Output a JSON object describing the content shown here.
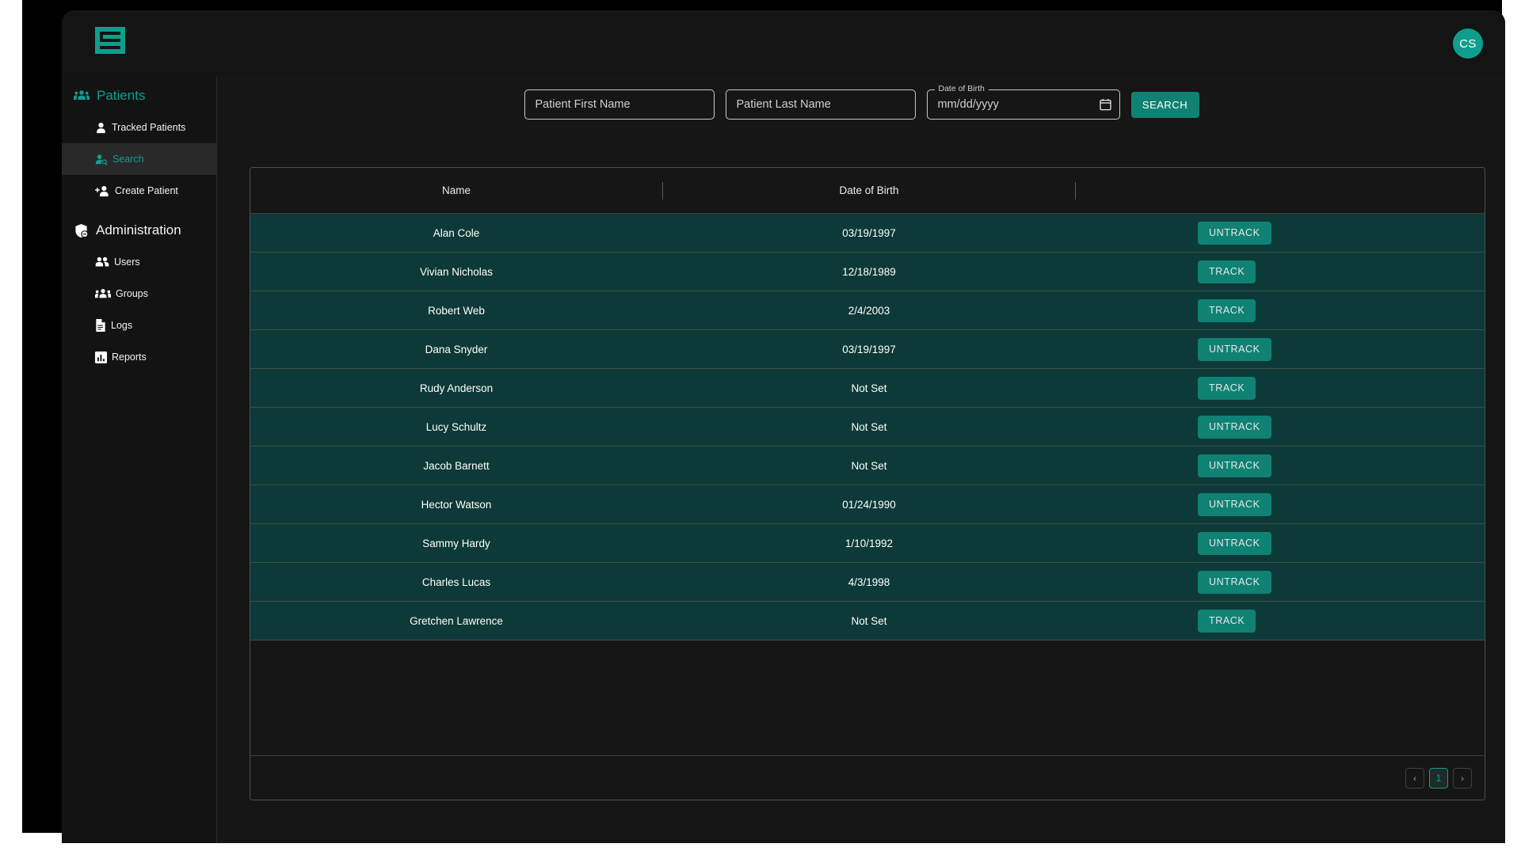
{
  "brand": {
    "logo_icon": "s-monogram-logo",
    "accent_color": "#0f9e8e",
    "button_color": "#0f8274",
    "row_color": "#0d3a38",
    "panel_color": "#161616"
  },
  "topbar": {
    "avatar_initials": "CS"
  },
  "sidebar": {
    "groups": [
      {
        "label": "Patients",
        "icon": "group-people-icon",
        "items": [
          {
            "label": "Tracked Patients",
            "icon": "person-icon",
            "active": false
          },
          {
            "label": "Search",
            "icon": "person-search-icon",
            "active": true
          },
          {
            "label": "Create Patient",
            "icon": "person-add-icon",
            "active": false
          }
        ]
      },
      {
        "label": "Administration",
        "icon": "admin-shield-icon",
        "items": [
          {
            "label": "Users",
            "icon": "users-icon",
            "active": false
          },
          {
            "label": "Groups",
            "icon": "groups-icon",
            "active": false
          },
          {
            "label": "Logs",
            "icon": "document-icon",
            "active": false
          },
          {
            "label": "Reports",
            "icon": "bar-chart-icon",
            "active": false
          }
        ]
      }
    ]
  },
  "search": {
    "first_name_placeholder": "Patient First Name",
    "first_name_value": "",
    "last_name_placeholder": "Patient Last Name",
    "last_name_value": "",
    "dob_legend": "Date of Birth",
    "dob_placeholder": "mm/dd/yyyy",
    "dob_value": "",
    "calendar_icon": "calendar-icon",
    "search_button_label": "SEARCH"
  },
  "table": {
    "columns": [
      "Name",
      "Date of Birth",
      ""
    ],
    "rows": [
      {
        "name": "Alan Cole",
        "dob": "03/19/1997",
        "action": "UNTRACK"
      },
      {
        "name": "Vivian Nicholas",
        "dob": "12/18/1989",
        "action": "TRACK"
      },
      {
        "name": "Robert Web",
        "dob": "2/4/2003",
        "action": "TRACK"
      },
      {
        "name": "Dana Snyder",
        "dob": "03/19/1997",
        "action": "UNTRACK"
      },
      {
        "name": "Rudy Anderson",
        "dob": "Not Set",
        "action": "TRACK"
      },
      {
        "name": "Lucy Schultz",
        "dob": "Not Set",
        "action": "UNTRACK"
      },
      {
        "name": "Jacob Barnett",
        "dob": "Not Set",
        "action": "UNTRACK"
      },
      {
        "name": "Hector Watson",
        "dob": "01/24/1990",
        "action": "UNTRACK"
      },
      {
        "name": "Sammy Hardy",
        "dob": "1/10/1992",
        "action": "UNTRACK"
      },
      {
        "name": "Charles Lucas",
        "dob": "4/3/1998",
        "action": "UNTRACK"
      },
      {
        "name": "Gretchen Lawrence",
        "dob": "Not Set",
        "action": "TRACK"
      }
    ]
  },
  "pagination": {
    "prev_label": "‹",
    "current_page": "1",
    "next_label": "›"
  }
}
